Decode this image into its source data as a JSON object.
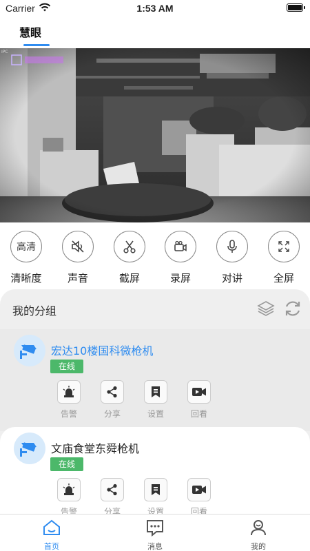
{
  "status_bar": {
    "carrier": "Carrier",
    "time": "1:53 AM"
  },
  "top_tab": {
    "label": "慧眼"
  },
  "video": {
    "watermark": "IPC"
  },
  "controls": [
    {
      "text": "高清",
      "label": "清晰度",
      "icon": "hd-text-icon"
    },
    {
      "label": "声音",
      "icon": "speaker-mute-icon"
    },
    {
      "label": "截屏",
      "icon": "scissors-icon"
    },
    {
      "label": "录屏",
      "icon": "video-camera-icon"
    },
    {
      "label": "对讲",
      "icon": "microphone-icon"
    },
    {
      "label": "全屏",
      "icon": "fullscreen-icon"
    }
  ],
  "group": {
    "title": "我的分组"
  },
  "cameras": [
    {
      "name": "宏达10楼国科微枪机",
      "status": "在线",
      "actions": [
        "告警",
        "分享",
        "设置",
        "回看"
      ]
    },
    {
      "name": "文庙食堂东舜枪机",
      "status": "在线",
      "actions": [
        "告警",
        "分享",
        "设置",
        "回看"
      ]
    }
  ],
  "tabbar": {
    "home": "首页",
    "messages": "消息",
    "mine": "我的"
  },
  "colors": {
    "accent": "#2f8cf0",
    "online": "#4cb86a"
  }
}
